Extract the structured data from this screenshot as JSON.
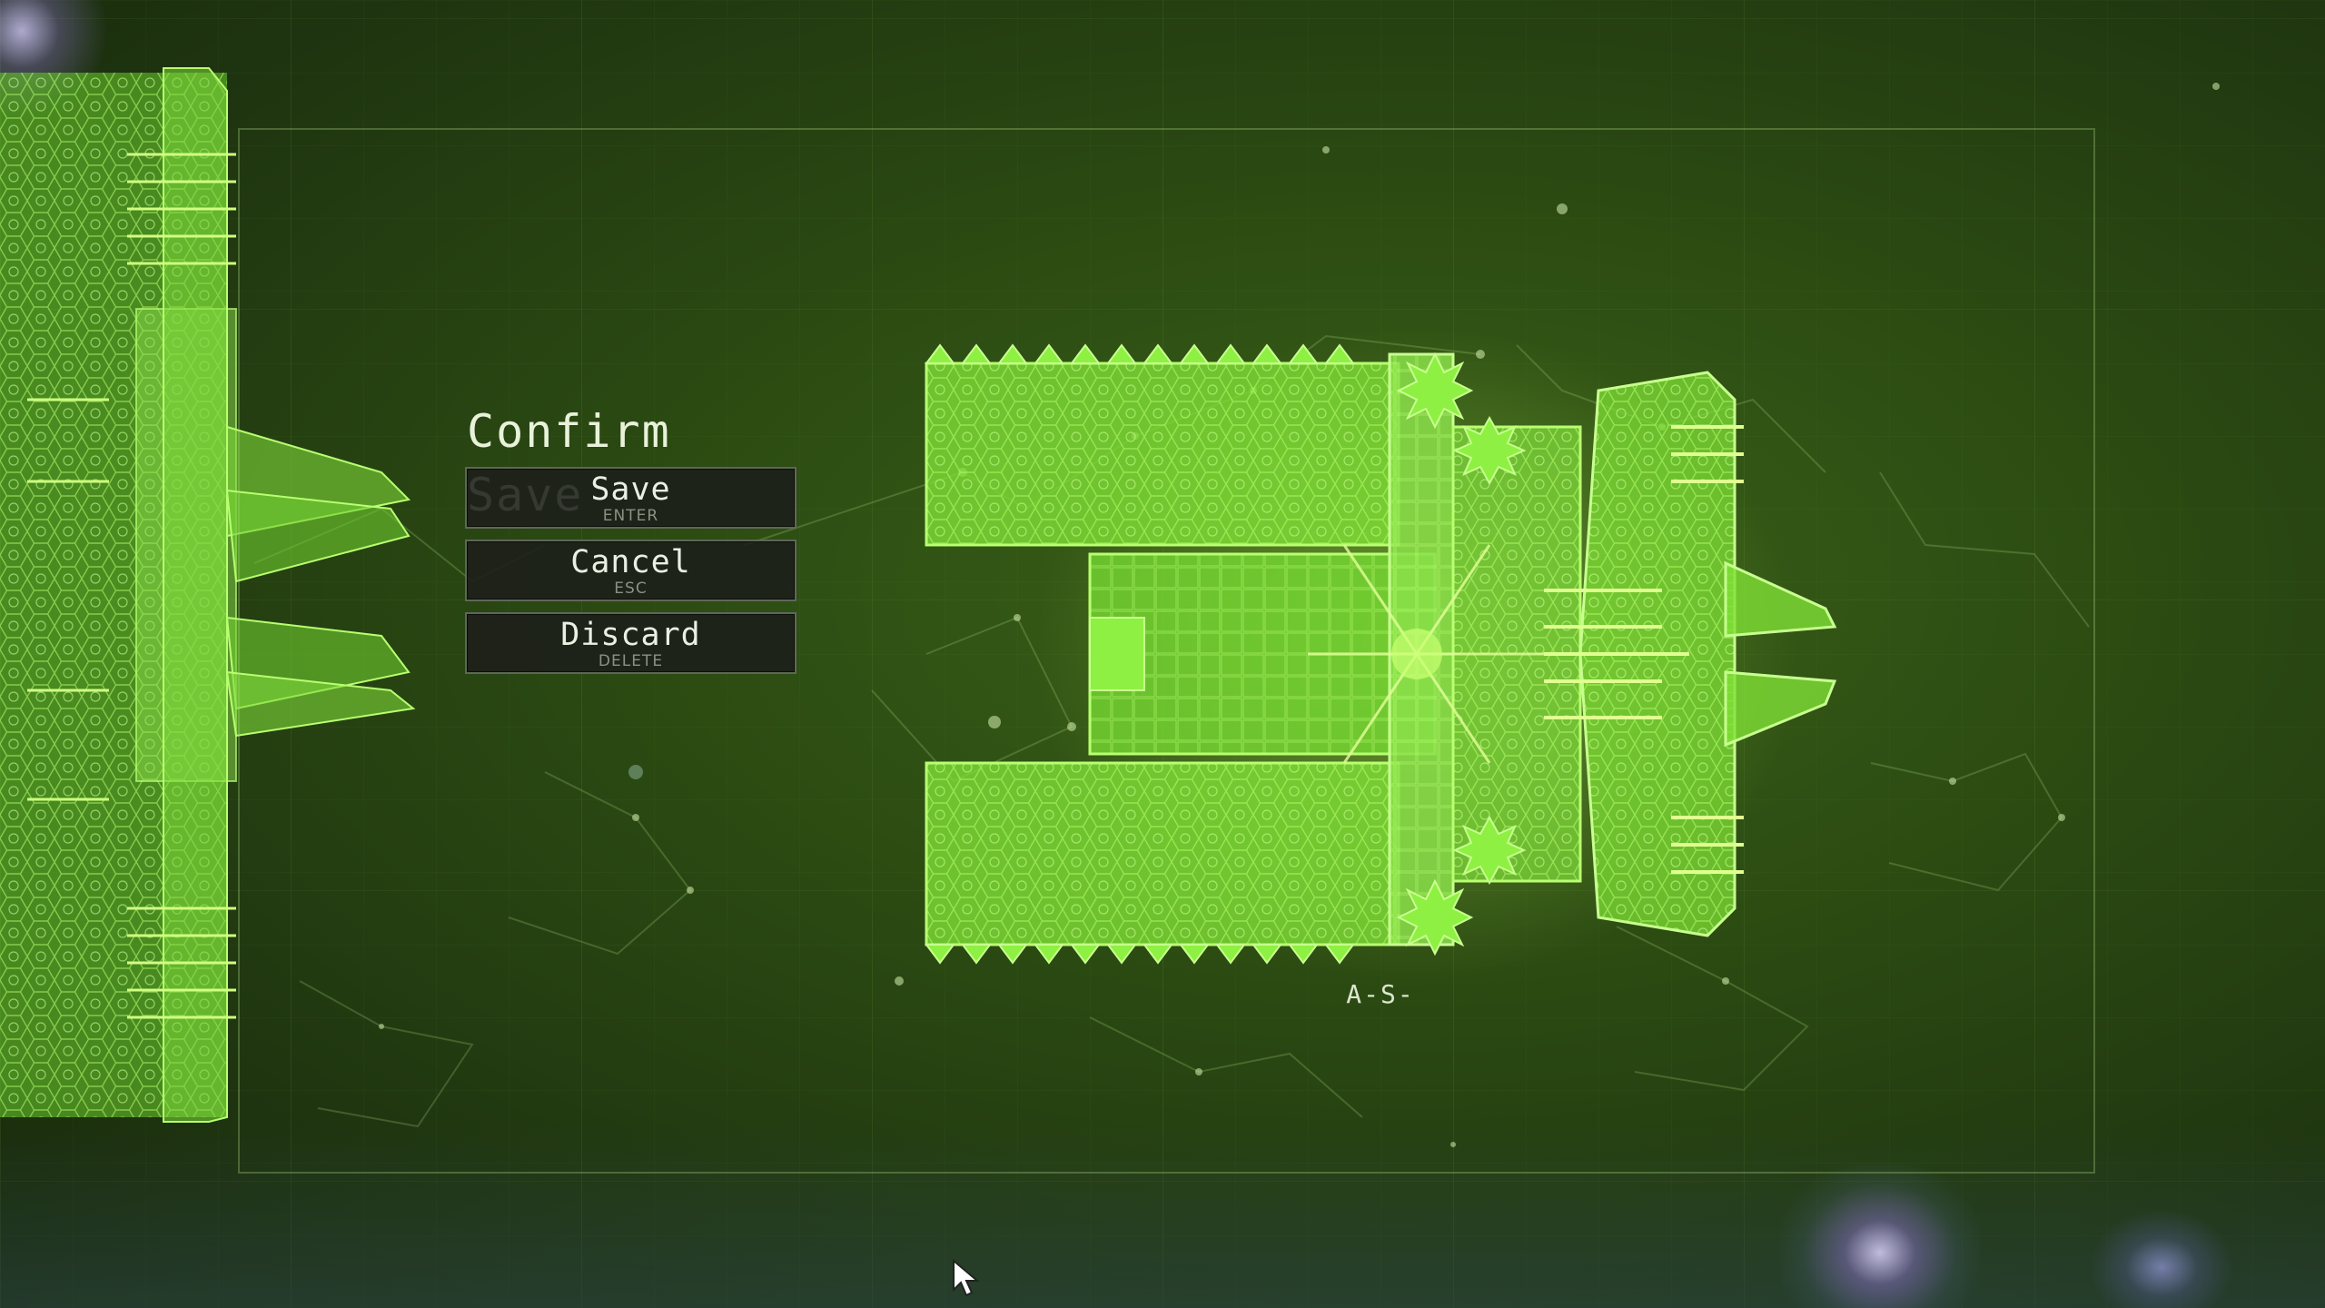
{
  "dialog": {
    "title": "Confirm Save",
    "buttons": [
      {
        "label": "Save",
        "hotkey": "ENTER"
      },
      {
        "label": "Cancel",
        "hotkey": "ESC"
      },
      {
        "label": "Discard",
        "hotkey": "DELETE"
      }
    ]
  },
  "ship": {
    "name": "A-S-"
  },
  "colors": {
    "background": "#2b4a12",
    "ship_green": "#7fe036",
    "ship_outline": "#b8ff70",
    "button_bg": "#1c1e1a",
    "text": "#e8f2da"
  },
  "icons": [
    "mouse-cursor-icon"
  ]
}
